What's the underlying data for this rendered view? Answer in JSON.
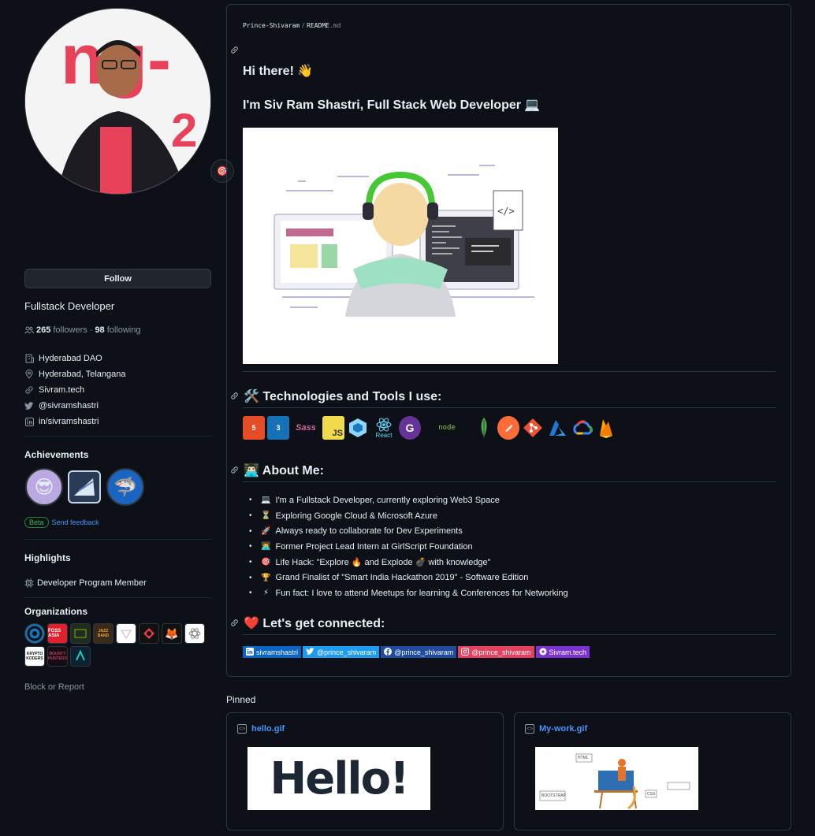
{
  "profile": {
    "bio": "Fullstack Developer",
    "follow_label": "Follow",
    "followers_count": "265",
    "followers_label": "followers",
    "separator": "·",
    "following_count": "98",
    "following_label": "following",
    "status_emoji": "🎯",
    "details": [
      {
        "icon": "organization-icon",
        "text": "Hyderabad DAO"
      },
      {
        "icon": "location-icon",
        "text": "Hyderabad, Telangana"
      },
      {
        "icon": "link-icon",
        "text": "Sivram.tech"
      },
      {
        "icon": "twitter-icon",
        "text": "@sivramshastri"
      },
      {
        "icon": "linkedin-icon",
        "text": "in/sivramshastri"
      }
    ],
    "achievements_title": "Achievements",
    "beta_label": "Beta",
    "feedback_label": "Send feedback",
    "highlights_title": "Highlights",
    "highlight_item": "Developer Program Member",
    "organizations_title": "Organizations",
    "org_labels": [
      "",
      "FOSS ASIA",
      "",
      "JAZZ BAND",
      "",
      "",
      "",
      "",
      "KRYPTO KODERS",
      "BOUNTY HUNTERS",
      ""
    ],
    "block_label": "Block or Report"
  },
  "readme": {
    "owner": "Prince-Shivaram",
    "slash": "/",
    "file": "README",
    "ext": ".md",
    "greeting": "Hi there! 👋",
    "intro": "I'm Siv Ram Shastri, Full Stack Web Developer 💻",
    "tech_heading": "🛠️ Technologies and Tools I use:",
    "tech_labels": [
      "5",
      "3",
      "Sass",
      "JS",
      "",
      "React",
      "G",
      "node",
      "",
      "",
      "",
      "",
      "",
      "",
      ""
    ],
    "about_heading": "👨🏻‍💻 About Me:",
    "about_items": [
      {
        "emoji": "💻",
        "text": "I'm a Fullstack Developer, currently exploring Web3 Space"
      },
      {
        "emoji": "⏳",
        "text": "Exploring Google Cloud & Microsoft Azure"
      },
      {
        "emoji": "🚀",
        "text": "Always ready to collaborate for Dev Experiments"
      },
      {
        "emoji": "👨‍💻",
        "text": "Former Project Lead Intern at GirlScript Foundation"
      },
      {
        "emoji": "🎯",
        "text": "Life Hack: \"Explore 🔥 and Explode 💣 with knowledge\""
      },
      {
        "emoji": "🏆",
        "text": "Grand Finalist of \"Smart India Hackathon 2019\" - Software Edition"
      },
      {
        "emoji": "⚡",
        "text": "Fun fact: I love to attend Meetups for learning & Conferences for Networking"
      }
    ],
    "connect_heading": "❤️ Let's get connected:",
    "socials": [
      {
        "icon": "linkedin-icon",
        "text": "sivramshastri",
        "color": "#0a66c2"
      },
      {
        "icon": "twitter-icon",
        "text": "@prince_shivaram",
        "color": "#1d9bf0"
      },
      {
        "icon": "facebook-icon",
        "text": "@prince_shivaram",
        "color": "#1877f2"
      },
      {
        "icon": "instagram-icon",
        "text": "@prince_shivaram",
        "color": "#e4405f"
      },
      {
        "icon": "website-icon",
        "text": "Sivram.tech",
        "color": "#7b34d1"
      }
    ]
  },
  "pinned": {
    "title": "Pinned",
    "items": [
      {
        "name": "hello.gif",
        "preview_text": "Hello!"
      },
      {
        "name": "My-work.gif",
        "preview_labels": [
          "HTML",
          "BOOTSTRAP",
          "CSS"
        ]
      }
    ]
  },
  "colors": {
    "bg": "#0d1117",
    "border": "#30363d",
    "link": "#4493f8",
    "muted": "#8b949e"
  }
}
